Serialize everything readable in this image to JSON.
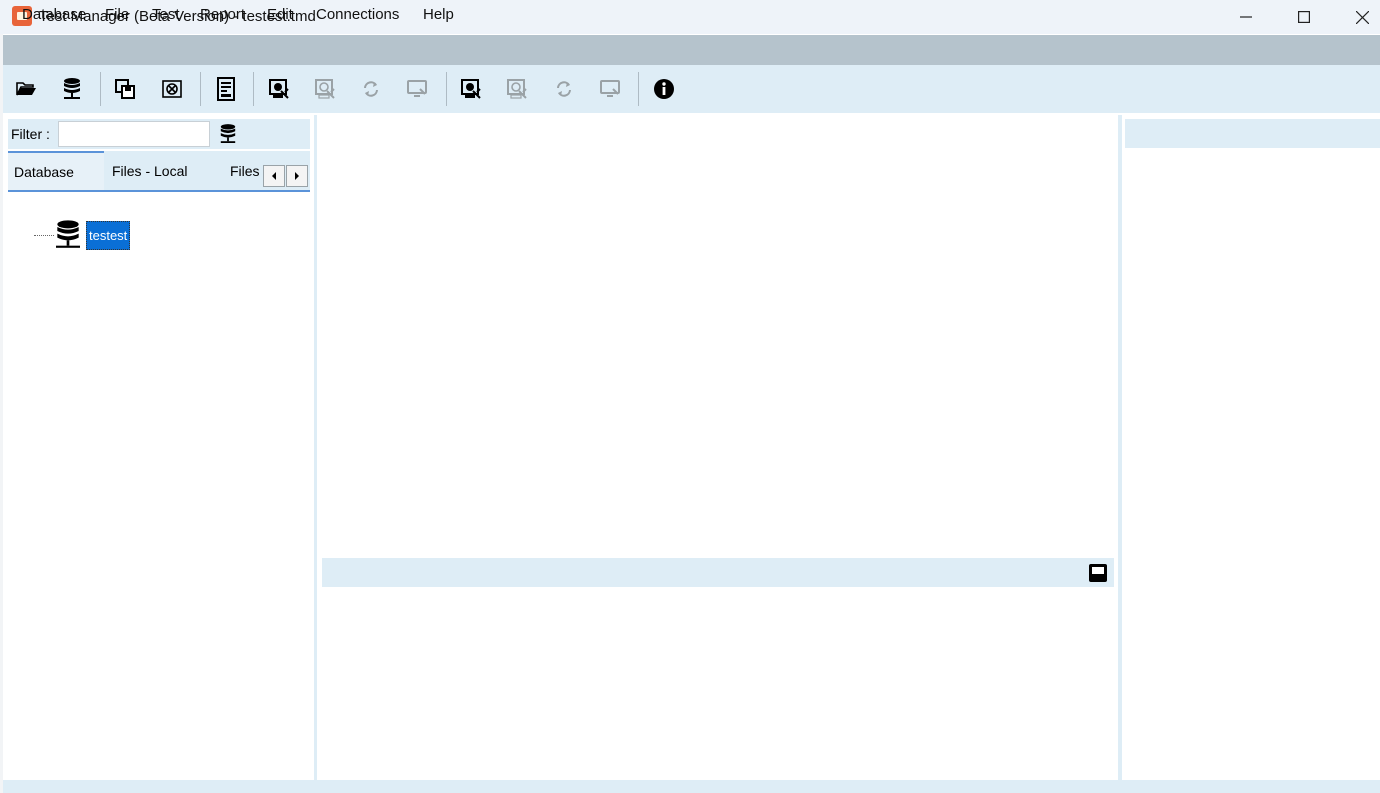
{
  "window": {
    "title": "Test Manager (Beta Version) - testest.tmd",
    "controls": {
      "minimize": "—",
      "maximize": "☐",
      "close": "✕"
    }
  },
  "menu": {
    "items": [
      "Database",
      "File",
      "Test",
      "Report",
      "Edit",
      "Connections",
      "Help"
    ]
  },
  "toolbar": {
    "buttons": [
      {
        "icon": "open-folder-icon",
        "enabled": true
      },
      {
        "icon": "database-icon",
        "enabled": true
      },
      {
        "icon": "save-copy-icon",
        "enabled": true
      },
      {
        "icon": "close-doc-icon",
        "enabled": true
      },
      {
        "icon": "report-icon",
        "enabled": true
      },
      {
        "icon": "connect-icon",
        "enabled": true
      },
      {
        "icon": "connect-icon",
        "enabled": false
      },
      {
        "icon": "refresh-icon",
        "enabled": false
      },
      {
        "icon": "monitor-icon",
        "enabled": false
      },
      {
        "icon": "connect-icon",
        "enabled": true
      },
      {
        "icon": "connect-icon",
        "enabled": false
      },
      {
        "icon": "refresh-icon",
        "enabled": false
      },
      {
        "icon": "monitor-icon",
        "enabled": false
      },
      {
        "icon": "info-icon",
        "enabled": true
      }
    ]
  },
  "left_panel": {
    "filter": {
      "label": "Filter :",
      "value": "",
      "placeholder": ""
    },
    "tabs": [
      "Database",
      "Files - Local",
      "Files"
    ],
    "active_tab": "Database",
    "tree": [
      {
        "label": "testest",
        "icon": "database-icon",
        "selected": true
      }
    ]
  },
  "colors": {
    "panel_bg": "#deedf6",
    "menubar_bg": "#b5c3cc",
    "selection": "#0a6fd6",
    "tab_accent": "#5b93d9"
  }
}
